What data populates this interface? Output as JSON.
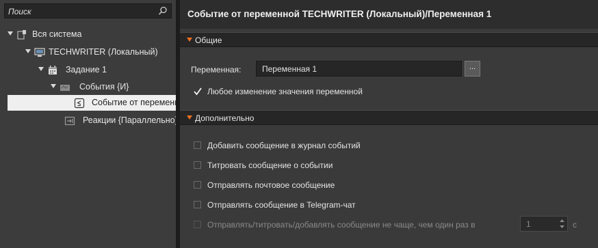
{
  "search": {
    "placeholder": "Поиск",
    "icon": "search-icon"
  },
  "tree": [
    {
      "label": "Вся система",
      "icon": "system-icon"
    },
    {
      "label": "TECHWRITER (Локальный)",
      "icon": "computer-icon"
    },
    {
      "label": "Задание 1",
      "icon": "calendar-icon"
    },
    {
      "label": "События {И}",
      "icon": "events-icon"
    },
    {
      "label": "Событие от переменной",
      "icon": "variable-event-icon"
    },
    {
      "label": "Реакции {Параллельно}",
      "icon": "reactions-icon"
    }
  ],
  "title": "Событие от переменной TECHWRITER (Локальный)/Переменная 1",
  "general": {
    "header": "Общие",
    "variable_label": "Переменная:",
    "variable_value": "Переменная 1",
    "browse_button": "...",
    "any_change_label": "Любое изменение значения переменной",
    "any_change_checked": true
  },
  "advanced": {
    "header": "Дополнительно",
    "options": [
      "Добавить сообщение в журнал событий",
      "Титровать сообщение о событии",
      "Отправлять почтовое сообщение",
      "Отправлять сообщение в Telegram-чат"
    ],
    "throttle_label": "Отправлять/титровать/добавлять сообщение не чаще, чем один раз в",
    "throttle_value": "1",
    "throttle_unit": "с"
  },
  "colors": {
    "accent": "#f07020",
    "selected_row": "#efefef"
  }
}
